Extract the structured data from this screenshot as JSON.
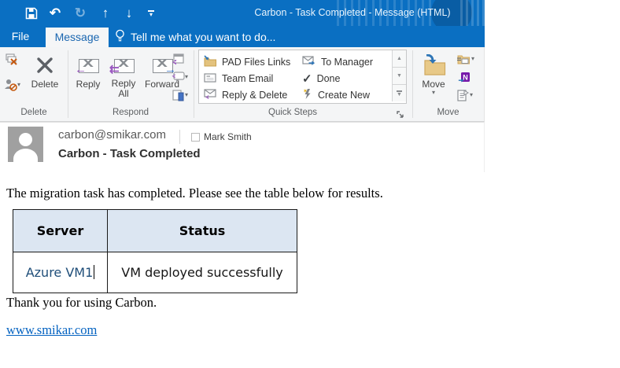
{
  "colors": {
    "titlebar_blue": "#0a6fc2",
    "active_tab_text": "#1a66b0",
    "table_header_bg": "#dce6f2",
    "link_blue": "#0563c1",
    "server_text_blue": "#1f4e79"
  },
  "window": {
    "title": "Carbon - Task Completed - Message (HTML)",
    "qat_icons": [
      "save-icon",
      "undo-icon",
      "redo-icon",
      "move-up-icon",
      "move-down-icon",
      "customize-quick-access-icon"
    ]
  },
  "tabs": {
    "file": "File",
    "message": "Message",
    "tell_me": "Tell me what you want to do..."
  },
  "ribbon": {
    "delete_group": {
      "label": "Delete",
      "delete_button": "Delete"
    },
    "respond_group": {
      "label": "Respond",
      "reply": "Reply",
      "reply_all": "Reply All",
      "forward": "Forward"
    },
    "quick_steps_group": {
      "label": "Quick Steps",
      "items": [
        {
          "label": "PAD Files Links",
          "icon": "folder-arrow-icon"
        },
        {
          "label": "Team Email",
          "icon": "email-document-icon"
        },
        {
          "label": "Reply & Delete",
          "icon": "envelope-reply-icon"
        },
        {
          "label": "To Manager",
          "icon": "envelope-forward-icon"
        },
        {
          "label": "Done",
          "icon": "checkmark-icon"
        },
        {
          "label": "Create New",
          "icon": "lightning-icon"
        }
      ]
    },
    "move_group": {
      "label": "Move",
      "move_button": "Move"
    }
  },
  "message": {
    "sender": "carbon@smikar.com",
    "recipient": "Mark Smith",
    "subject": "Carbon - Task Completed"
  },
  "body": {
    "intro": "The migration task has completed. Please see the table below for results.",
    "table": {
      "headers": [
        "Server",
        "Status"
      ],
      "rows": [
        [
          "Azure VM1",
          "VM deployed successfully"
        ]
      ]
    },
    "outro": "Thank you for using Carbon.",
    "link": "www.smikar.com"
  }
}
